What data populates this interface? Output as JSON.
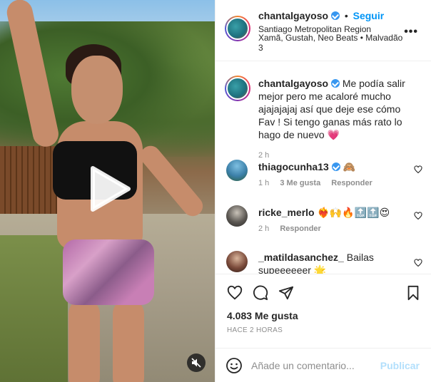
{
  "post": {
    "username": "chantalgayoso",
    "follow_label": "Seguir",
    "location": "Santiago Metropolitan Region",
    "audio_line": "Xamã, Gustah, Neo Beats • Malvadão",
    "audio_line_cont": "3",
    "more_label": "•••"
  },
  "caption": {
    "username": "chantalgayoso",
    "text": "Me podía salir mejor pero me acaloré mucho ajajajajaj así que deje ese cómo Fav ! Si tengo ganas más rato lo hago de nuevo 💗",
    "time": "2 h"
  },
  "comments": [
    {
      "username": "thiagocunha13",
      "text": "🙈",
      "time": "1 h",
      "likes": "3 Me gusta",
      "reply": "Responder",
      "verified": true
    },
    {
      "username": "ricke_merlo",
      "text": "❤️‍🔥🙌🔥🔝🔝😍",
      "time": "2 h",
      "likes": "",
      "reply": "Responder",
      "verified": false
    },
    {
      "username": "_matildasanchez_",
      "text": "Bailas supeeeeeer 🌟",
      "time": "",
      "likes": "",
      "reply": "",
      "verified": false
    }
  ],
  "stats": {
    "likes": "4.083 Me gusta",
    "posted": "HACE 2 HORAS"
  },
  "composer": {
    "placeholder": "Añade un comentario...",
    "publish_label": "Publicar"
  },
  "colors": {
    "accent": "#0095f6",
    "verified": "#3897f0"
  }
}
